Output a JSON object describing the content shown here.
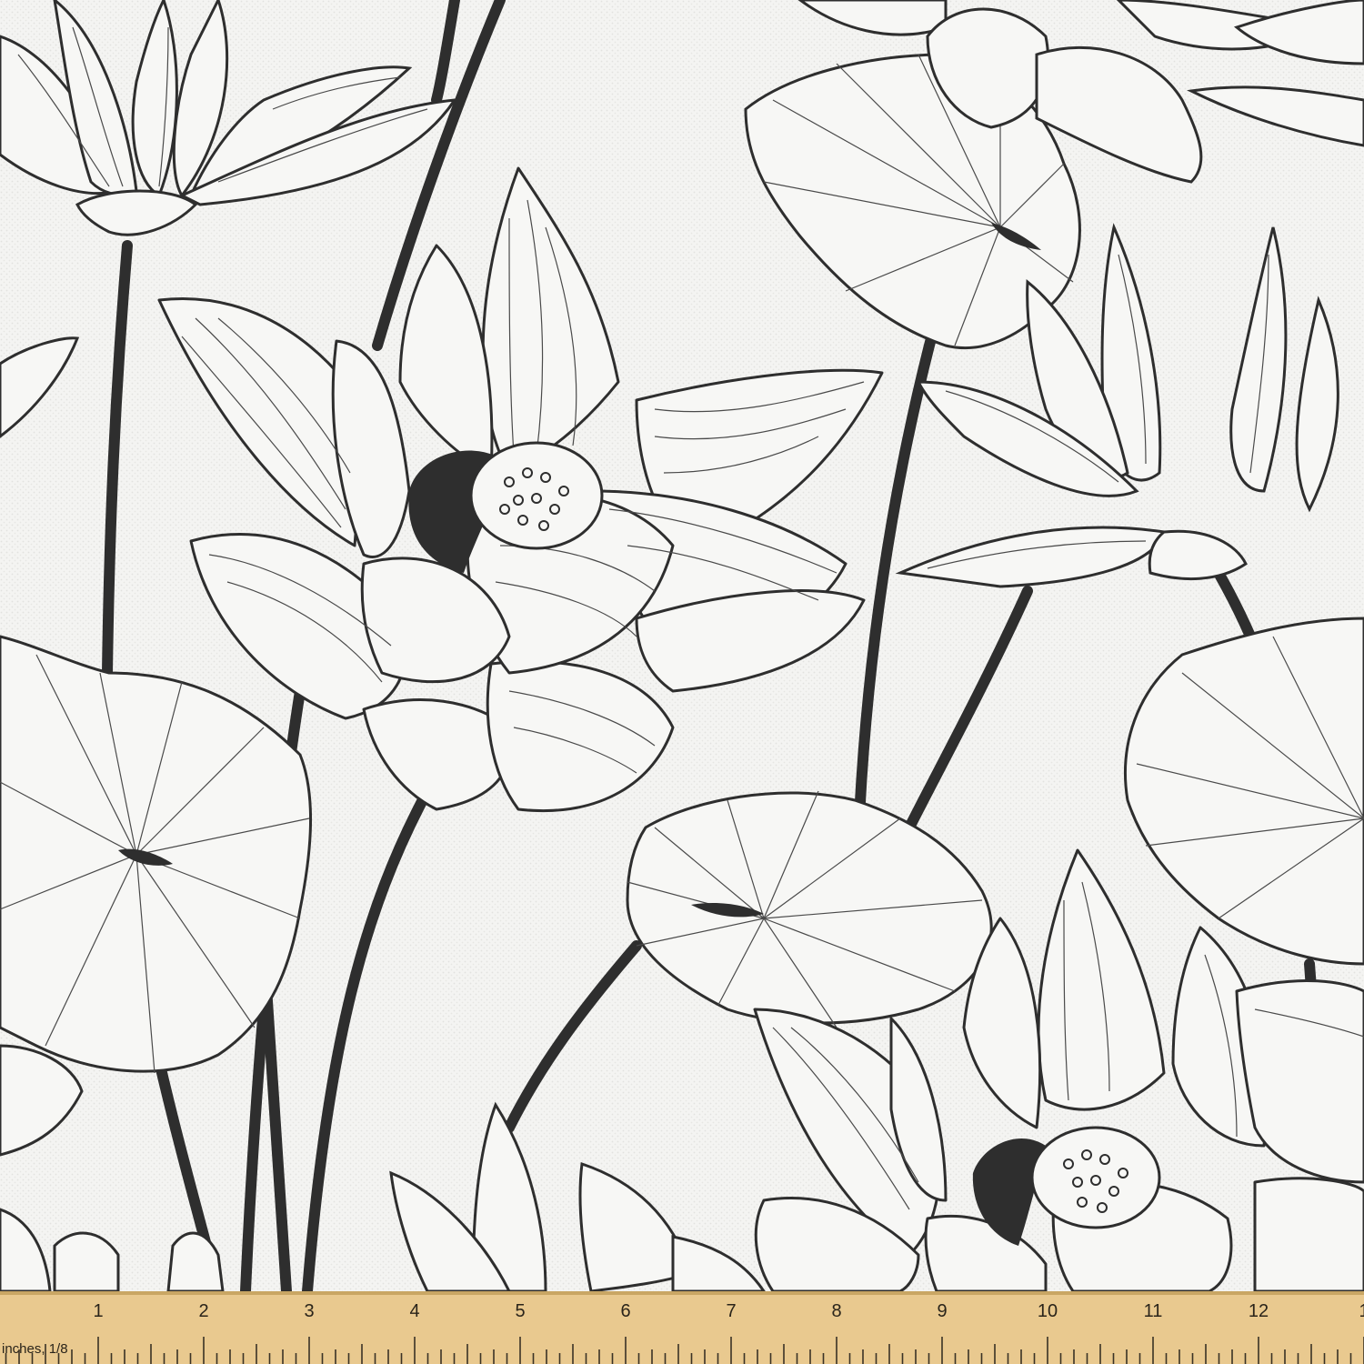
{
  "image": {
    "subject": "lotus-line-art-fabric-swatch",
    "line_color": "#2e2e2e",
    "background_color": "#f4f4f2",
    "ruler_color": "#e9c98f",
    "ruler_edge_color": "#c9a664"
  },
  "ruler": {
    "unit_label": "inches, 1/8",
    "numbers": [
      "1",
      "2",
      "3",
      "4",
      "5",
      "6",
      "7",
      "8",
      "9",
      "10",
      "11",
      "12",
      "1"
    ]
  }
}
